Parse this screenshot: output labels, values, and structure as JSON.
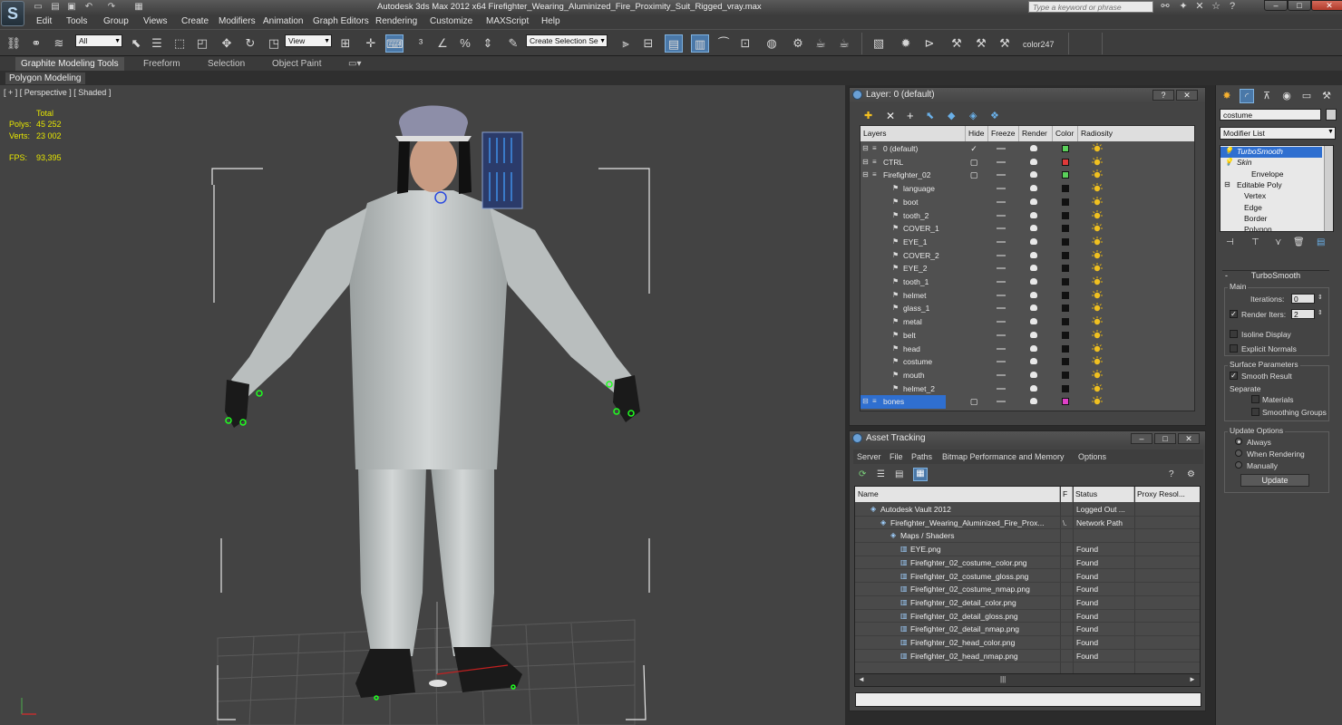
{
  "app": {
    "logo": "S",
    "title": "Autodesk 3ds Max  2012 x64    Firefighter_Wearing_Aluminized_Fire_Proximity_Suit_Rigged_vray.max",
    "search_placeholder": "Type a keyword or phrase"
  },
  "menu": [
    "Edit",
    "Tools",
    "Group",
    "Views",
    "Create",
    "Modifiers",
    "Animation",
    "Graph Editors",
    "Rendering",
    "Customize",
    "MAXScript",
    "Help"
  ],
  "toolbar": {
    "selection_filter": "All",
    "ref_coord": "View",
    "named_selection": "Create Selection Se",
    "color_label": "color247"
  },
  "ribbon": {
    "tabs": [
      "Graphite Modeling Tools",
      "Freeform",
      "Selection",
      "Object Paint"
    ],
    "sub": "Polygon Modeling"
  },
  "viewport": {
    "label": "[ + ] [ Perspective ] [ Shaded ]",
    "stats_header": "Total",
    "polys_label": "Polys:",
    "polys_value": "45 252",
    "verts_label": "Verts:",
    "verts_value": "23 002",
    "fps_label": "FPS:",
    "fps_value": "93,395"
  },
  "layer_panel": {
    "title": "Layer: 0 (default)",
    "columns": [
      "Layers",
      "Hide",
      "Freeze",
      "Render",
      "Color",
      "Radiosity"
    ],
    "rows": [
      {
        "name": "0 (default)",
        "indent": 0,
        "color": "#5ad05a",
        "hidecheck": true
      },
      {
        "name": "CTRL",
        "indent": 0,
        "color": "#e03a3a",
        "hidebox": true
      },
      {
        "name": "Firefighter_02",
        "indent": 0,
        "color": "#5ad05a",
        "hidebox": true
      },
      {
        "name": "language",
        "indent": 1,
        "color": "#111111"
      },
      {
        "name": "boot",
        "indent": 1,
        "color": "#111111"
      },
      {
        "name": "tooth_2",
        "indent": 1,
        "color": "#111111"
      },
      {
        "name": "COVER_1",
        "indent": 1,
        "color": "#111111"
      },
      {
        "name": "EYE_1",
        "indent": 1,
        "color": "#111111"
      },
      {
        "name": "COVER_2",
        "indent": 1,
        "color": "#111111"
      },
      {
        "name": "EYE_2",
        "indent": 1,
        "color": "#111111"
      },
      {
        "name": "tooth_1",
        "indent": 1,
        "color": "#111111"
      },
      {
        "name": "helmet",
        "indent": 1,
        "color": "#111111"
      },
      {
        "name": "glass_1",
        "indent": 1,
        "color": "#111111"
      },
      {
        "name": "metal",
        "indent": 1,
        "color": "#111111"
      },
      {
        "name": "belt",
        "indent": 1,
        "color": "#111111"
      },
      {
        "name": "head",
        "indent": 1,
        "color": "#111111"
      },
      {
        "name": "costume",
        "indent": 1,
        "color": "#111111"
      },
      {
        "name": "mouth",
        "indent": 1,
        "color": "#111111"
      },
      {
        "name": "helmet_2",
        "indent": 1,
        "color": "#111111"
      },
      {
        "name": "bones",
        "indent": 0,
        "color": "#e040c8",
        "selected": true,
        "hidebox": true
      }
    ]
  },
  "asset_panel": {
    "title": "Asset Tracking",
    "menu": [
      "Server",
      "File",
      "Paths",
      "Bitmap Performance and Memory",
      "Options"
    ],
    "columns": [
      "Name",
      "F",
      "Status",
      "Proxy Resol..."
    ],
    "rows": [
      {
        "name": "Autodesk Vault 2012",
        "indent": 1,
        "f": "",
        "status": "Logged Out ..."
      },
      {
        "name": "Firefighter_Wearing_Aluminized_Fire_Prox...",
        "indent": 2,
        "f": "\\.",
        "status": "Network Path"
      },
      {
        "name": "Maps / Shaders",
        "indent": 3,
        "f": "",
        "status": ""
      },
      {
        "name": "EYE.png",
        "indent": 4,
        "f": "",
        "status": "Found"
      },
      {
        "name": "Firefighter_02_costume_color.png",
        "indent": 4,
        "f": "",
        "status": "Found"
      },
      {
        "name": "Firefighter_02_costume_gloss.png",
        "indent": 4,
        "f": "",
        "status": "Found"
      },
      {
        "name": "Firefighter_02_costume_nmap.png",
        "indent": 4,
        "f": "",
        "status": "Found"
      },
      {
        "name": "Firefighter_02_detail_color.png",
        "indent": 4,
        "f": "",
        "status": "Found"
      },
      {
        "name": "Firefighter_02_detail_gloss.png",
        "indent": 4,
        "f": "",
        "status": "Found"
      },
      {
        "name": "Firefighter_02_detail_nmap.png",
        "indent": 4,
        "f": "",
        "status": "Found"
      },
      {
        "name": "Firefighter_02_head_color.png",
        "indent": 4,
        "f": "",
        "status": "Found"
      },
      {
        "name": "Firefighter_02_head_nmap.png",
        "indent": 4,
        "f": "",
        "status": "Found"
      }
    ]
  },
  "command_panel": {
    "object_name": "costume",
    "modifier_list": "Modifier List",
    "stack": [
      {
        "name": "TurboSmooth",
        "selected": true,
        "indent": 0,
        "italic": true
      },
      {
        "name": "Skin",
        "indent": 0,
        "italic": true
      },
      {
        "name": "Envelope",
        "indent": 2
      },
      {
        "name": "Editable Poly",
        "indent": 0
      },
      {
        "name": "Vertex",
        "indent": 1
      },
      {
        "name": "Edge",
        "indent": 1
      },
      {
        "name": "Border",
        "indent": 1
      },
      {
        "name": "Polygon",
        "indent": 1
      }
    ],
    "rollout_title": "TurboSmooth",
    "main_group": "Main",
    "iterations_label": "Iterations:",
    "iterations_value": "0",
    "render_iters_label": "Render Iters:",
    "render_iters_value": "2",
    "isoline_label": "Isoline Display",
    "explicit_normals_label": "Explicit Normals",
    "surface_group": "Surface Parameters",
    "smooth_result_label": "Smooth Result",
    "separate_label": "Separate",
    "materials_label": "Materials",
    "smoothing_groups_label": "Smoothing Groups",
    "update_group": "Update Options",
    "always_label": "Always",
    "when_rendering_label": "When Rendering",
    "manually_label": "Manually",
    "update_button": "Update"
  }
}
